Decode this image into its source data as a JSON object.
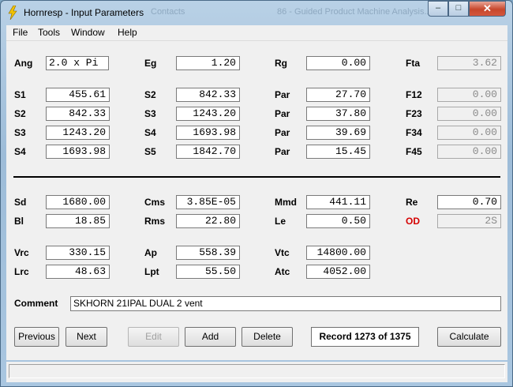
{
  "window": {
    "title": "Hornresp - Input Parameters",
    "background_text_1": "Contacts",
    "background_text_2": "86 - Guided Product Machine Analysis..."
  },
  "title_buttons": {
    "minimize": "–",
    "maximize": "□",
    "close": "✕"
  },
  "menu": [
    "File",
    "Tools",
    "Window",
    "Help"
  ],
  "fields": {
    "Ang": "2.0 x Pi",
    "Eg": "1.20",
    "Rg": "0.00",
    "Fta": "3.62",
    "S1": "455.61",
    "S2a": "842.33",
    "Par1": "27.70",
    "F12": "0.00",
    "S2b": "842.33",
    "S3a": "1243.20",
    "Par2": "37.80",
    "F23": "0.00",
    "S3b": "1243.20",
    "S4a": "1693.98",
    "Par3": "39.69",
    "F34": "0.00",
    "S4b": "1693.98",
    "S5": "1842.70",
    "Par4": "15.45",
    "F45": "0.00",
    "Sd": "1680.00",
    "Cms": "3.85E-05",
    "Mmd": "441.11",
    "Re": "0.70",
    "Bl": "18.85",
    "Rms": "22.80",
    "Le": "0.50",
    "OD": "2S",
    "Vrc": "330.15",
    "Ap": "558.39",
    "Vtc": "14800.00",
    "Lrc": "48.63",
    "Lpt": "55.50",
    "Atc": "4052.00"
  },
  "labels": {
    "Ang": "Ang",
    "Eg": "Eg",
    "Rg": "Rg",
    "Fta": "Fta",
    "S1": "S1",
    "S2": "S2",
    "S3": "S3",
    "S4": "S4",
    "S5": "S5",
    "Par": "Par",
    "F12": "F12",
    "F23": "F23",
    "F34": "F34",
    "F45": "F45",
    "Sd": "Sd",
    "Cms": "Cms",
    "Mmd": "Mmd",
    "Re": "Re",
    "Bl": "Bl",
    "Rms": "Rms",
    "Le": "Le",
    "OD": "OD",
    "Vrc": "Vrc",
    "Ap": "Ap",
    "Vtc": "Vtc",
    "Lrc": "Lrc",
    "Lpt": "Lpt",
    "Atc": "Atc",
    "Comment": "Comment"
  },
  "comment_value": "SKHORN 21IPAL DUAL 2 vent",
  "buttons": {
    "previous": "Previous",
    "next": "Next",
    "edit": "Edit",
    "add": "Add",
    "delete": "Delete",
    "calculate": "Calculate"
  },
  "record_label": "Record 1273 of 1375",
  "colors": {
    "od_label": "#d40000",
    "window_frame": "#9dbcd8",
    "close_button": "#c7472c"
  }
}
